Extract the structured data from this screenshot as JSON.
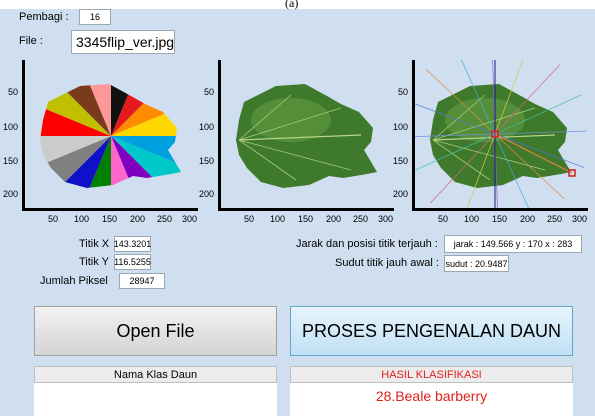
{
  "top_caption": "(a)",
  "pembagi": {
    "label": "Pembagi :",
    "value": "16"
  },
  "file": {
    "label": "File :",
    "value": "3345flip_ver.jpg"
  },
  "axes": {
    "y_ticks": [
      "50",
      "100",
      "150",
      "200"
    ],
    "x_ticks": [
      "50",
      "100",
      "150",
      "200",
      "250",
      "300"
    ]
  },
  "info": {
    "titik_x_label": "Titik X",
    "titik_x_value": "143.3201",
    "titik_y_label": "Titik Y",
    "titik_y_value": "116.5255",
    "jumlah_label": "Jumlah Piksel",
    "jumlah_value": "28947",
    "jarak_label": "Jarak dan posisi titik terjauh  :",
    "jarak_value": "jarak : 149.566 y : 170  x : 283",
    "sudut_label": "Sudut titik jauh awal  :",
    "sudut_value": "sudut : 20.9487"
  },
  "buttons": {
    "open": "Open File",
    "process": "PROSES PENGENALAN DAUN"
  },
  "panels": {
    "class_header": "Nama Klas Daun",
    "result_header": "HASIL KLASIFIKASI",
    "result_value": "28.Beale barberry",
    "result_color": "#e0201c"
  },
  "colors": {
    "window_bg": "#cfdff0",
    "leaf": "#3f7a2c",
    "marker": "#d22020",
    "wedges": [
      "#111111",
      "#e41a1c",
      "#ff8c00",
      "#ffd700",
      "#00a0e0",
      "#00c8c8",
      "#8000c0",
      "#ff66cc",
      "#008000",
      "#1010c8",
      "#808080",
      "#cccccc",
      "#ff0000",
      "#c0c000",
      "#7a3b1c",
      "#ff9999"
    ]
  }
}
